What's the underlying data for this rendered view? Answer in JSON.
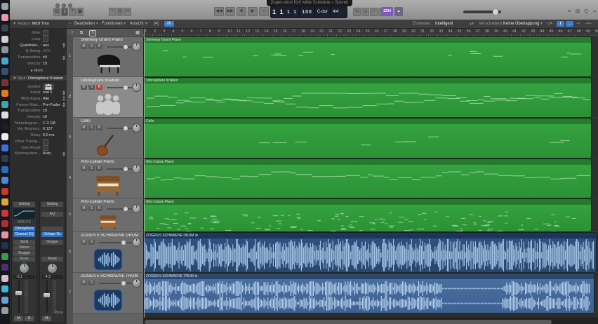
{
  "window": {
    "title": "Zogen einst fünf wilde Schwäne – Spuren"
  },
  "chrome": {
    "toolbar_buttons": [
      {
        "name": "library-icon",
        "glyph": "▤"
      },
      {
        "name": "inspector-icon",
        "glyph": "i"
      },
      {
        "name": "quick-help-icon",
        "glyph": "?"
      },
      {
        "name": "toolbar-icon",
        "glyph": "▣"
      },
      {
        "name": "settings-icon",
        "glyph": "*"
      },
      {
        "name": "mixer-icon",
        "glyph": "|||"
      },
      {
        "name": "cut-icon",
        "glyph": "✂"
      }
    ],
    "transport": {
      "rewind": "◀◀",
      "forward": "▶▶",
      "stop": "■",
      "play": "▶",
      "record": "●"
    },
    "lcd": {
      "bar": "1",
      "beat": "1",
      "division": "1",
      "tick": "1",
      "tempo": "100",
      "key": "C-dur",
      "time_signature": "4/4"
    },
    "mode_buttons": [
      {
        "name": "cycle-icon",
        "glyph": "⟲"
      },
      {
        "name": "replace-icon",
        "glyph": "⊙"
      },
      {
        "name": "autopunch-icon",
        "glyph": "∕"
      },
      {
        "name": "low-latency-icon",
        "glyph": "□"
      }
    ],
    "count_in_label": "1234",
    "metronome_glyph": "▲"
  },
  "menu_bar": {
    "items": [
      "Bearbeiten",
      "Funktionen",
      "Ansicht"
    ],
    "snap_label": "Einrasten:",
    "snap_value": "Intelligent",
    "move_label": "Verschieben:",
    "move_value": "Keine Überlappung"
  },
  "track_header_bar": {
    "plus_label": "+",
    "s_label": "S"
  },
  "inspector": {
    "region_section": {
      "prefix": "Region:",
      "name": "MIDI Thru",
      "rows": [
        {
          "label": "Mute:",
          "value": "",
          "control": "checkbox"
        },
        {
          "label": "Loop:",
          "value": "",
          "control": "checkbox"
        },
        {
          "label": "Quantisier...:",
          "value": "aus",
          "control": "stepper",
          "bright": true
        },
        {
          "label": "Q-Swing:",
          "value": "50%",
          "dim": true
        },
        {
          "label": "Transposition:",
          "value": "±0",
          "control": "stepper"
        },
        {
          "label": "Velocity:",
          "value": "±0"
        }
      ],
      "more_label": "Mehr"
    },
    "track_section": {
      "prefix": "Spur:",
      "name": "Omnisphere Knaben",
      "rows": [
        {
          "label": "Symbol:",
          "value": "",
          "control": "icon"
        },
        {
          "label": "Kanal:",
          "value": "Inst 5",
          "control": "stepper"
        },
        {
          "label": "MIDI-Kanal:",
          "value": "Alle",
          "control": "stepper"
        },
        {
          "label": "Freeze-Mod...:",
          "value": "Pre-Fader",
          "control": "stepper"
        },
        {
          "label": "Transposition:",
          "value": "±0"
        },
        {
          "label": "Velocity:",
          "value": "±0"
        },
        {
          "label": "Notenbegren...:",
          "value": "C-2   G8"
        },
        {
          "label": "Vel.-Begrenz.:",
          "value": "0   127"
        },
        {
          "label": "Delay:",
          "value": "0,0 ms"
        },
        {
          "label": "Ohne Transp...:",
          "value": "",
          "control": "checkbox"
        },
        {
          "label": "Kein Reset:",
          "value": "",
          "control": "checkbox"
        },
        {
          "label": "Notensystem...:",
          "value": "Auto.",
          "control": "stepper"
        }
      ]
    },
    "channel_strips": [
      {
        "setting": "Setting",
        "eq_area": "curve",
        "under_eq_label": "MIDI-FX",
        "slot_a": "Omnisphere",
        "slot_b": "Channel EQ",
        "extra_rows": [
          "Send",
          "Stereo",
          "Gruppe"
        ],
        "automation": "Read",
        "level": "-5.1",
        "footer_label": "",
        "footer_buttons": [
          "M",
          "S"
        ]
      },
      {
        "setting": "Setting",
        "eq_area": "button",
        "eq_button": "EQ",
        "slot_a": "",
        "slot_b": "iZotope Oz",
        "extra_rows": [
          "Gruppe"
        ],
        "automation": "Read",
        "level": "-4.3",
        "footer_label": "Bnce",
        "footer_buttons": [
          "M"
        ]
      }
    ]
  },
  "tracks": [
    {
      "num": "1",
      "name": "Steinway Grand Piano",
      "icon": "grand-piano",
      "controls": [
        "M",
        "S",
        "R"
      ],
      "selected": false,
      "type": "midi"
    },
    {
      "num": "2",
      "name": "Omnisphere Knaben",
      "icon": "choir",
      "controls": [
        "M",
        "S",
        "R"
      ],
      "record": true,
      "selected": true,
      "type": "midi"
    },
    {
      "num": "3",
      "name": "Cello",
      "icon": "cello",
      "controls": [
        "M",
        "S",
        "R"
      ],
      "selected": false,
      "type": "midi"
    },
    {
      "num": "4",
      "name": "Afro-Cuban Piano",
      "icon": "upright-piano",
      "controls": [
        "M",
        "S",
        "R"
      ],
      "selected": false,
      "type": "midi"
    },
    {
      "num": "5",
      "name": "Afro-Cuban Piano",
      "icon": "upright-piano",
      "controls": [
        "M",
        "S",
        "R"
      ],
      "selected": false,
      "type": "midi"
    },
    {
      "num": "6",
      "name": "ZOGEN 5 SCHWAENE DRUM",
      "icon": "audio-waveform",
      "controls": [
        "M",
        "S"
      ],
      "selected": false,
      "type": "audio"
    },
    {
      "num": "7",
      "name": "ZOGEN 5 SCHWAENE TRUM",
      "icon": "audio-waveform",
      "controls": [
        "M",
        "S"
      ],
      "selected": false,
      "type": "audio"
    }
  ],
  "regions": [
    {
      "name": "Steinway Grand Piano",
      "type": "midi"
    },
    {
      "name": "Omnisphere Knaben",
      "type": "midi"
    },
    {
      "name": "Cello",
      "type": "midi"
    },
    {
      "name": "Afro-Cuban Piano",
      "type": "midi"
    },
    {
      "name": "Afro-Cuban Piano",
      "type": "midi"
    },
    {
      "name": "ZOGEN 5 SCHWAENE DRUM",
      "type": "audio"
    },
    {
      "name": "ZOGEN 5 SCHWAENE TRUM",
      "type": "audio"
    }
  ],
  "ruler": {
    "first_bar": 1,
    "last_bar": 50
  },
  "colors": {
    "accent_blue": "#3b7dd8",
    "region_green": "#2f9b3a",
    "audio_region_dark": "#2b4d77",
    "audio_region_light": "#41679f",
    "waveform": "#a9c9e9",
    "record_red": "#c23b2e",
    "count_in_purple": "#7e57c2"
  },
  "dock": {
    "icon_colors": [
      "#9aa2aa",
      "#e09ab2",
      "#3c4250",
      "#d0d0d4",
      "#8a929a",
      "#4aa6cc",
      "#355270",
      "#7e3030",
      "#e07a1e",
      "#3aa6aa",
      "#dcdcdc",
      "#1e1e22",
      "#eaeaea",
      "#3a70d8",
      "#2c3c50",
      "#2a6ac0",
      "#4a8ad8",
      "#c03a2e",
      "#d8a83a",
      "#c43a3a",
      "#b03030",
      "#e890aa",
      "#243252",
      "#3a9858",
      "#4a3070",
      "#d8bcd0",
      "#38b8d8",
      "#6aa0dc",
      "#9a9aa2"
    ]
  }
}
